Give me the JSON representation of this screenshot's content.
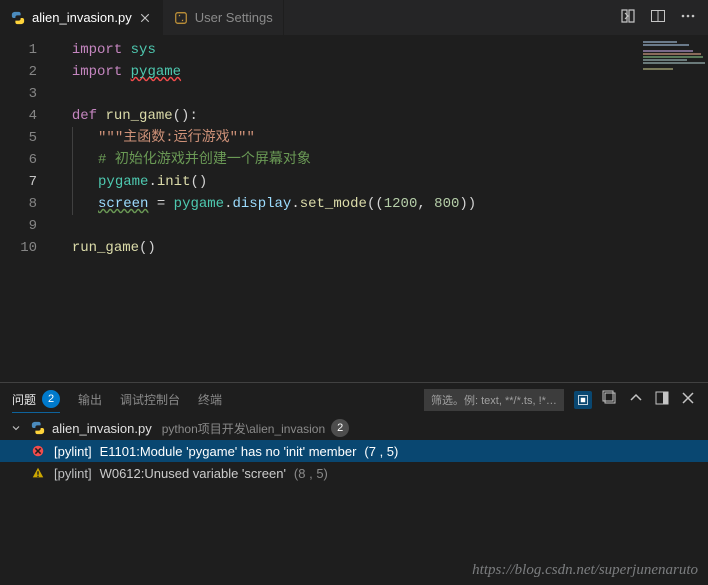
{
  "tabs": [
    {
      "label": "alien_invasion.py",
      "icon": "python-file-icon",
      "active": true,
      "dirty": false
    },
    {
      "label": "User Settings",
      "icon": "settings-json-icon",
      "active": false,
      "dirty": false
    }
  ],
  "title_actions": [
    "compare-icon",
    "split-editor-icon",
    "more-icon"
  ],
  "editor": {
    "active_line": 7,
    "lines": [
      {
        "n": 1,
        "tokens": [
          [
            "kw",
            "import"
          ],
          [
            "pn",
            " "
          ],
          [
            "mod",
            "sys"
          ]
        ]
      },
      {
        "n": 2,
        "tokens": [
          [
            "kw",
            "import"
          ],
          [
            "pn",
            " "
          ],
          [
            "mod squiggle-red",
            "pygame"
          ]
        ]
      },
      {
        "n": 3,
        "tokens": []
      },
      {
        "n": 4,
        "tokens": [
          [
            "kw",
            "def"
          ],
          [
            "pn",
            " "
          ],
          [
            "fn",
            "run_game"
          ],
          [
            "pn",
            "():"
          ]
        ]
      },
      {
        "n": 5,
        "indent": 1,
        "tokens": [
          [
            "str",
            "\"\"\"主函数:运行游戏\"\"\""
          ]
        ]
      },
      {
        "n": 6,
        "indent": 1,
        "tokens": [
          [
            "cmt",
            "# 初始化游戏并创建一个屏幕对象"
          ]
        ]
      },
      {
        "n": 7,
        "indent": 1,
        "tokens": [
          [
            "mod",
            "pygame"
          ],
          [
            "pn",
            "."
          ],
          [
            "fn",
            "init"
          ],
          [
            "pn",
            "()"
          ]
        ]
      },
      {
        "n": 8,
        "indent": 1,
        "tokens": [
          [
            "id squiggle-grn",
            "screen"
          ],
          [
            "pn",
            " = "
          ],
          [
            "mod",
            "pygame"
          ],
          [
            "pn",
            "."
          ],
          [
            "id",
            "display"
          ],
          [
            "pn",
            "."
          ],
          [
            "fn",
            "set_mode"
          ],
          [
            "pn",
            "(("
          ],
          [
            "num",
            "1200"
          ],
          [
            "pn",
            ", "
          ],
          [
            "num",
            "800"
          ],
          [
            "pn",
            "))"
          ]
        ]
      },
      {
        "n": 9,
        "tokens": []
      },
      {
        "n": 10,
        "tokens": [
          [
            "fn",
            "run_game"
          ],
          [
            "pn",
            "()"
          ]
        ]
      }
    ]
  },
  "panel": {
    "tabs": [
      {
        "label": "问题",
        "badge": "2",
        "active": true
      },
      {
        "label": "输出",
        "active": false
      },
      {
        "label": "调试控制台",
        "active": false
      },
      {
        "label": "终端",
        "active": false
      }
    ],
    "filter_placeholder": "筛选。例: text, **/*.ts, !**/...",
    "actions": [
      "filter-ext-icon",
      "collapse-all-icon",
      "chevron-up-icon",
      "toggle-layout-icon",
      "close-icon"
    ],
    "file": {
      "name": "alien_invasion.py",
      "path": "python项目开发\\alien_invasion",
      "count": "2"
    },
    "problems": [
      {
        "sev": "error",
        "source": "[pylint]",
        "message": "E1101:Module 'pygame' has no 'init' member",
        "loc": "(7 , 5)",
        "selected": true
      },
      {
        "sev": "warning",
        "source": "[pylint]",
        "message": "W0612:Unused variable 'screen'",
        "loc": "(8 , 5)",
        "selected": false
      }
    ]
  },
  "watermark": "https://blog.csdn.net/superjunenaruto"
}
